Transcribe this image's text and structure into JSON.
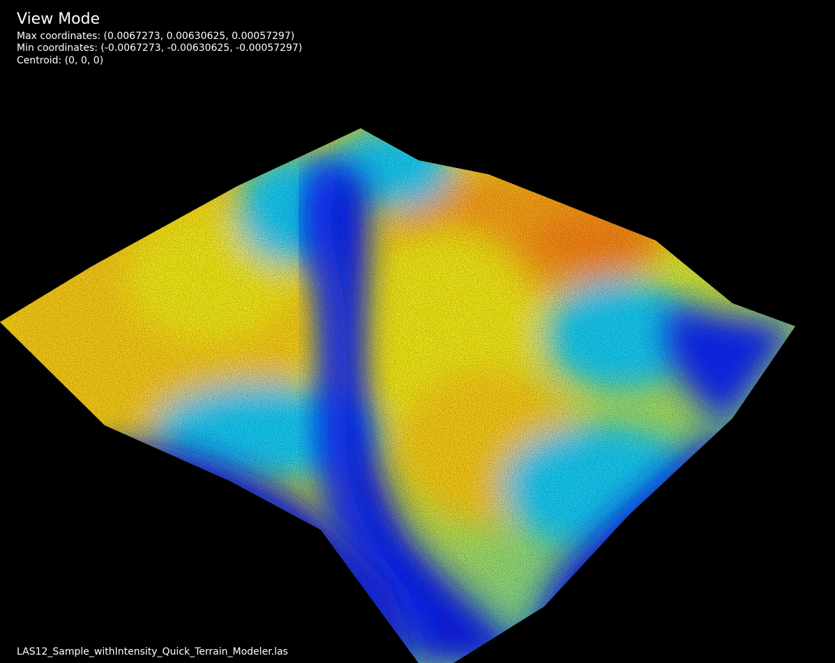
{
  "hud": {
    "mode": "View Mode",
    "max_coordinates": "Max coordinates: (0.0067273, 0.00630625, 0.00057297)",
    "min_coordinates": "Min coordinates: (-0.0067273, -0.00630625, -0.00057297)",
    "centroid": "Centroid: (0, 0, 0)"
  },
  "footer": {
    "filename": "LAS12_Sample_withIntensity_Quick_Terrain_Modeler.las"
  },
  "colors": {
    "background": "#000000",
    "low_elevation": "#0a1ee6",
    "mid_low_elevation": "#19c8f0",
    "mid_high_elevation": "#f0e614",
    "high_elevation": "#f58214",
    "text": "#ffffff"
  }
}
